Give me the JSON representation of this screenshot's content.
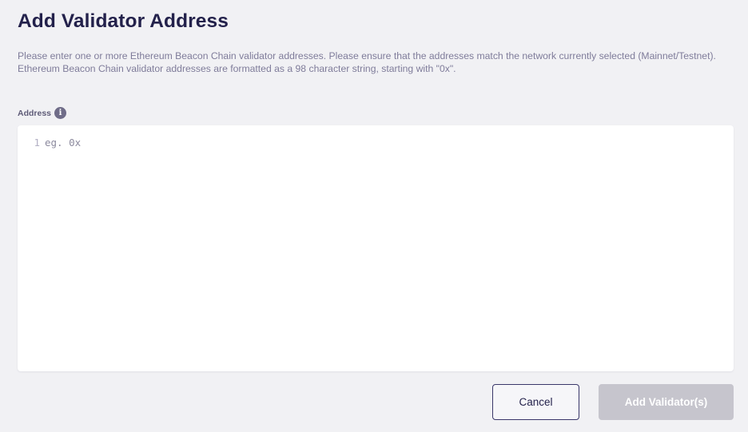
{
  "page": {
    "title": "Add Validator Address",
    "description_line1": "Please enter one or more Ethereum Beacon Chain validator addresses. Please ensure that the addresses match the network currently selected (Mainnet/Testnet).",
    "description_line2": "Ethereum Beacon Chain validator addresses are formatted as a 98 character string, starting with \"0x\"."
  },
  "field": {
    "label": "Address",
    "info_icon": "info-icon",
    "info_glyph": "i"
  },
  "editor": {
    "line_number": "1",
    "placeholder": "eg. 0x"
  },
  "buttons": {
    "cancel_label": "Cancel",
    "add_label": "Add Validator(s)",
    "add_disabled": true
  },
  "colors": {
    "background": "#f1f1f4",
    "title": "#23214b",
    "muted_text": "#7f7c9a",
    "disabled_button": "#c6c5cd",
    "cancel_border": "#3a376a"
  }
}
